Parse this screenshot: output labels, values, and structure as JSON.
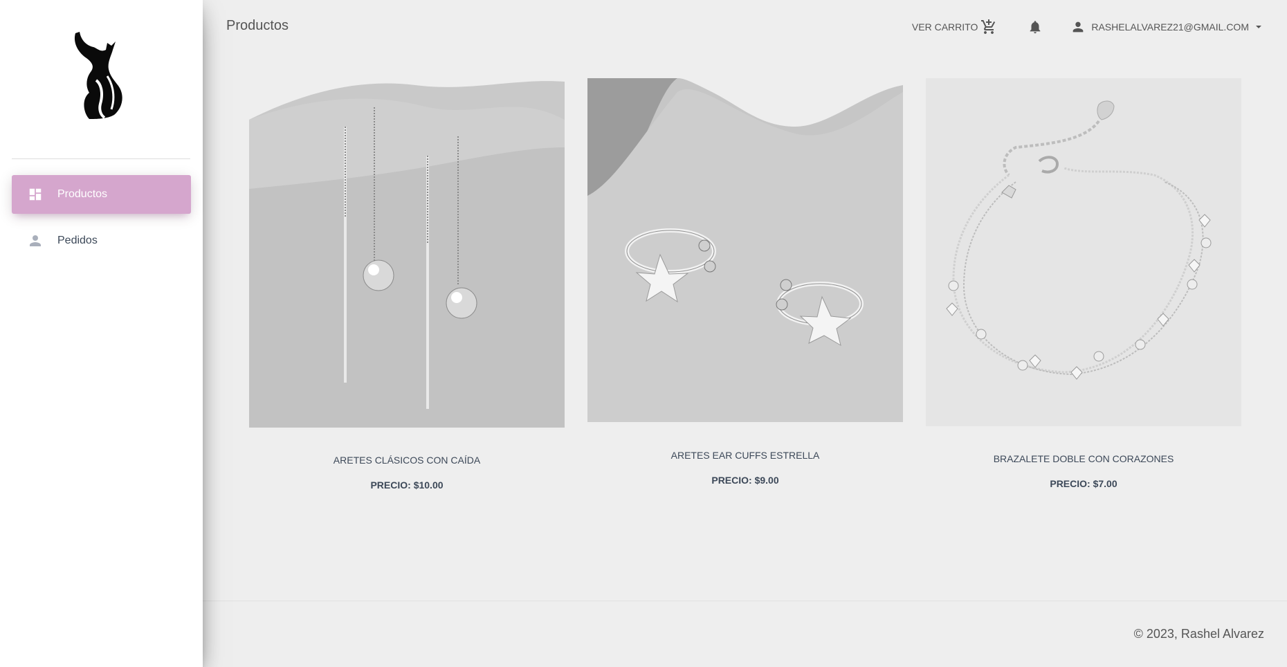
{
  "sidebar": {
    "items": [
      {
        "label": "Productos",
        "icon": "dashboard-icon",
        "active": true
      },
      {
        "label": "Pedidos",
        "icon": "person-icon",
        "active": false
      }
    ]
  },
  "header": {
    "title": "Productos",
    "cart_label": "VER CARRITO",
    "user_email": "RASHELALVAREZ21@GMAIL.COM"
  },
  "products": [
    {
      "name": "ARETES CLÁSICOS CON CAÍDA",
      "price": "PRECIO: $10.00"
    },
    {
      "name": "ARETES EAR CUFFS ESTRELLA",
      "price": "PRECIO: $9.00"
    },
    {
      "name": "BRAZALETE DOBLE CON CORAZONES",
      "price": "PRECIO: $7.00"
    }
  ],
  "footer": {
    "copyright": "© 2023, Rashel Alvarez"
  },
  "colors": {
    "accent": "#d5a6cd",
    "background": "#eeeeee",
    "text": "#3c4858"
  }
}
